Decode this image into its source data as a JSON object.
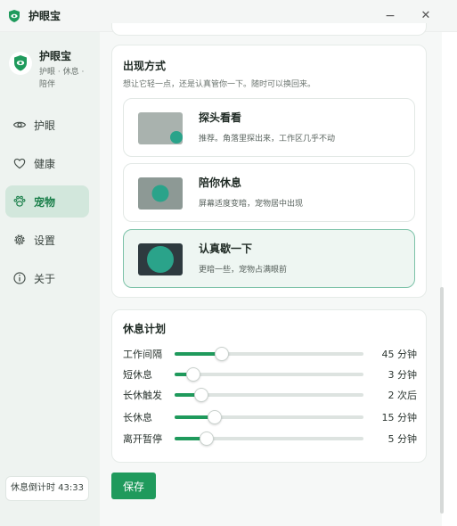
{
  "window": {
    "title": "护眼宝",
    "minimize_glyph": "−",
    "close_glyph": "✕"
  },
  "sidebar": {
    "brand_name": "护眼宝",
    "brand_sub": "护眼 · 休息 · 陪伴",
    "items": [
      {
        "label": "护眼",
        "icon": "eye-icon",
        "active": false
      },
      {
        "label": "健康",
        "icon": "heart-icon",
        "active": false
      },
      {
        "label": "宠物",
        "icon": "paw-icon",
        "active": true
      },
      {
        "label": "设置",
        "icon": "gear-icon",
        "active": false
      },
      {
        "label": "关于",
        "icon": "info-icon",
        "active": false
      }
    ],
    "timer": "休息倒计时 43:33"
  },
  "appearance": {
    "title": "出现方式",
    "subtitle": "想让它轻一点，还是认真管你一下。随时可以换回来。",
    "options": [
      {
        "title": "探头看看",
        "desc": "推荐。角落里探出来，工作区几乎不动",
        "selected": false
      },
      {
        "title": "陪你休息",
        "desc": "屏幕适度变暗，宠物居中出现",
        "selected": false
      },
      {
        "title": "认真歇一下",
        "desc": "更暗一些，宠物占满眼前",
        "selected": true
      }
    ]
  },
  "plan": {
    "title": "休息计划",
    "rows": [
      {
        "label": "工作间隔",
        "value": "45 分钟",
        "level": 0.25
      },
      {
        "label": "短休息",
        "value": "3 分钟",
        "level": 0.1
      },
      {
        "label": "长休触发",
        "value": "2 次后",
        "level": 0.14
      },
      {
        "label": "长休息",
        "value": "15 分钟",
        "level": 0.21
      },
      {
        "label": "离开暂停",
        "value": "5 分钟",
        "level": 0.17
      }
    ]
  },
  "actions": {
    "save_label": "保存"
  },
  "colors": {
    "accent": "#1f9a5c",
    "accent_dark": "#1a7f4a",
    "teal": "#2aa38a",
    "active_nav_bg": "#d2e7dc",
    "selected_option_bg": "#eef6f2"
  }
}
